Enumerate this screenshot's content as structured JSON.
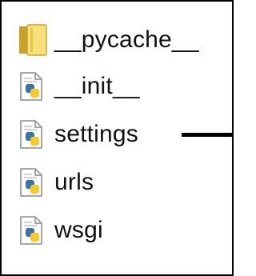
{
  "file_tree": {
    "items": [
      {
        "label": "__pycache__",
        "icon": "folder-icon"
      },
      {
        "label": "__init__",
        "icon": "python-file-icon"
      },
      {
        "label": "settings",
        "icon": "python-file-icon"
      },
      {
        "label": "urls",
        "icon": "python-file-icon"
      },
      {
        "label": "wsgi",
        "icon": "python-file-icon"
      }
    ]
  },
  "colors": {
    "folder_light": "#f7e07a",
    "folder_dark": "#c9a22c",
    "python_blue": "#3b73ab",
    "python_yellow": "#f5c92c",
    "arrow": "#000000",
    "border": "#000000"
  }
}
